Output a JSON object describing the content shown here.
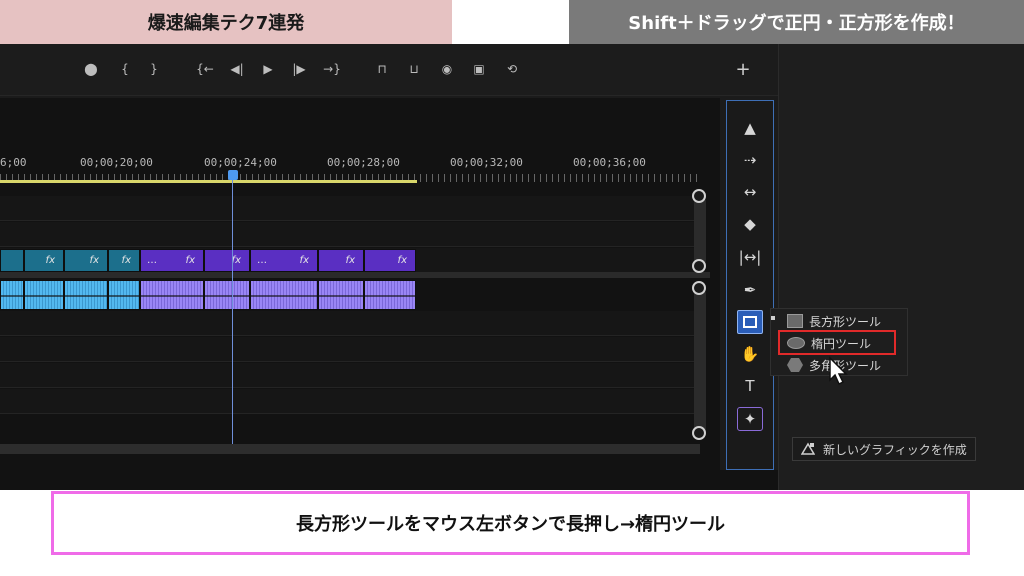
{
  "header": {
    "left_title": "爆速編集テク7連発",
    "right_title": "Shift＋ドラッグで正円・正方形を作成！"
  },
  "transport": {
    "buttons": [
      {
        "name": "add-marker-button",
        "glyph": "⬤"
      },
      {
        "name": "mark-in-button",
        "glyph": "{"
      },
      {
        "name": "mark-out-button",
        "glyph": "}"
      },
      {
        "name": "go-to-in-button",
        "glyph": "{←"
      },
      {
        "name": "step-back-button",
        "glyph": "◀|"
      },
      {
        "name": "play-button",
        "glyph": "▶"
      },
      {
        "name": "step-forward-button",
        "glyph": "|▶"
      },
      {
        "name": "go-to-out-button",
        "glyph": "→}"
      },
      {
        "name": "lift-button",
        "glyph": "⊓"
      },
      {
        "name": "extract-button",
        "glyph": "⊔"
      },
      {
        "name": "export-frame-button",
        "glyph": "◉"
      },
      {
        "name": "comparison-view-button",
        "glyph": "▣"
      },
      {
        "name": "vr-button",
        "glyph": "⟲"
      }
    ],
    "add_button_glyph": "+"
  },
  "timeline": {
    "timecodes": [
      "6;00",
      "00;00;20;00",
      "00;00;24;00",
      "00;00;28;00",
      "00;00;32;00",
      "00;00;36;00"
    ],
    "video_clips": [
      {
        "label": "",
        "dots": "",
        "color": "blue"
      },
      {
        "label": "fx",
        "dots": "",
        "color": "blue"
      },
      {
        "label": "fx",
        "dots": "",
        "color": "blue"
      },
      {
        "label": "fx",
        "dots": "",
        "color": "blue"
      },
      {
        "label": "fx",
        "dots": "…",
        "color": "purple"
      },
      {
        "label": "fx",
        "dots": "",
        "color": "purple"
      },
      {
        "label": "fx",
        "dots": "…",
        "color": "purple"
      },
      {
        "label": "fx",
        "dots": "",
        "color": "purple"
      },
      {
        "label": "fx",
        "dots": "",
        "color": "purple"
      }
    ]
  },
  "tools": [
    {
      "name": "selection-tool",
      "glyph": "▲"
    },
    {
      "name": "track-select-tool",
      "glyph": "⇢"
    },
    {
      "name": "ripple-edit-tool",
      "glyph": "↔"
    },
    {
      "name": "razor-tool",
      "glyph": "◆"
    },
    {
      "name": "slip-tool",
      "glyph": "|↔|"
    },
    {
      "name": "pen-tool",
      "glyph": "✒"
    },
    {
      "name": "rectangle-tool",
      "glyph": ""
    },
    {
      "name": "hand-tool",
      "glyph": "✋"
    },
    {
      "name": "type-tool",
      "glyph": "T"
    },
    {
      "name": "graphic-tool",
      "glyph": "✦"
    }
  ],
  "flyout": {
    "items": [
      {
        "label": "長方形ツール",
        "icon": "rectangle-icon"
      },
      {
        "label": "楕円ツール",
        "icon": "ellipse-icon"
      },
      {
        "label": "多角形ツール",
        "icon": "polygon-icon"
      }
    ]
  },
  "right_panel": {
    "new_graphic_label": "新しいグラフィックを作成"
  },
  "caption": "長方形ツールをマウス左ボタンで長押し→楕円ツール"
}
